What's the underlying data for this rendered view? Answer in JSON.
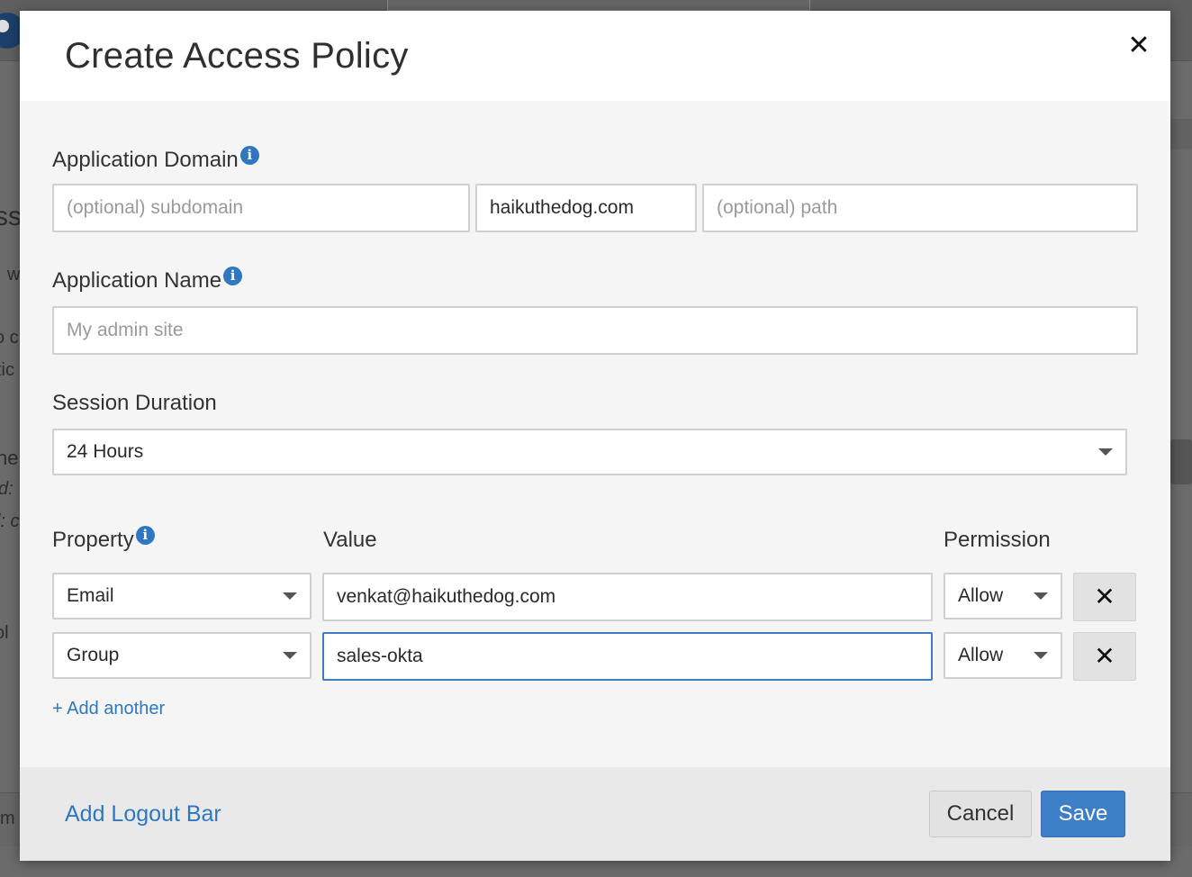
{
  "background": {
    "fragments": [
      "ss",
      "w",
      "o c",
      "tic",
      "he",
      "d:",
      "l: c",
      "ol",
      "m"
    ]
  },
  "modal": {
    "title": "Create Access Policy",
    "close_icon": "close-icon",
    "domain": {
      "label": "Application Domain",
      "subdomain_placeholder": "(optional) subdomain",
      "domain_value": "haikuthedog.com",
      "path_placeholder": "(optional) path"
    },
    "name": {
      "label": "Application Name",
      "placeholder": "My admin site"
    },
    "session": {
      "label": "Session Duration",
      "value": "24 Hours"
    },
    "rules": {
      "headers": {
        "property": "Property",
        "value": "Value",
        "permission": "Permission"
      },
      "rows": [
        {
          "property": "Email",
          "value": "venkat@haikuthedog.com",
          "permission": "Allow"
        },
        {
          "property": "Group",
          "value": "sales-okta",
          "permission": "Allow"
        }
      ],
      "add_another": "+ Add another"
    },
    "footer": {
      "logout_bar_link": "Add Logout Bar",
      "cancel_label": "Cancel",
      "save_label": "Save"
    },
    "colors": {
      "accent": "#3d7fc6",
      "link": "#2f78c0",
      "info": "#2f78c0"
    }
  }
}
